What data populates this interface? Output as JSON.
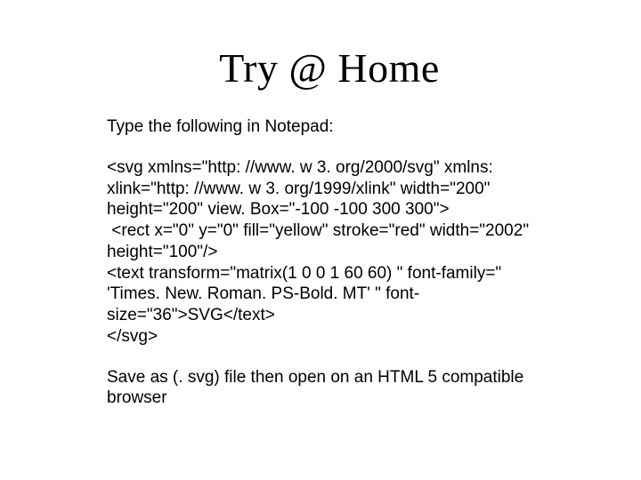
{
  "title": "Try @ Home",
  "subhead": "Type the following in Notepad:",
  "code": "<svg xmlns=\"http: //www. w 3. org/2000/svg\" xmlns: xlink=\"http: //www. w 3. org/1999/xlink\" width=\"200\" height=\"200\" view. Box=\"-100 -100 300 300\">\n <rect x=\"0\" y=\"0\" fill=\"yellow\" stroke=\"red\" width=\"2002\" height=\"100\"/>\n<text transform=\"matrix(1 0 0 1 60 60) \" font-family=\" 'Times. New. Roman. PS-Bold. MT' \" font-size=\"36\">SVG</text>\n</svg>",
  "footnote": "Save as (. svg) file then open on an HTML 5 compatible browser"
}
